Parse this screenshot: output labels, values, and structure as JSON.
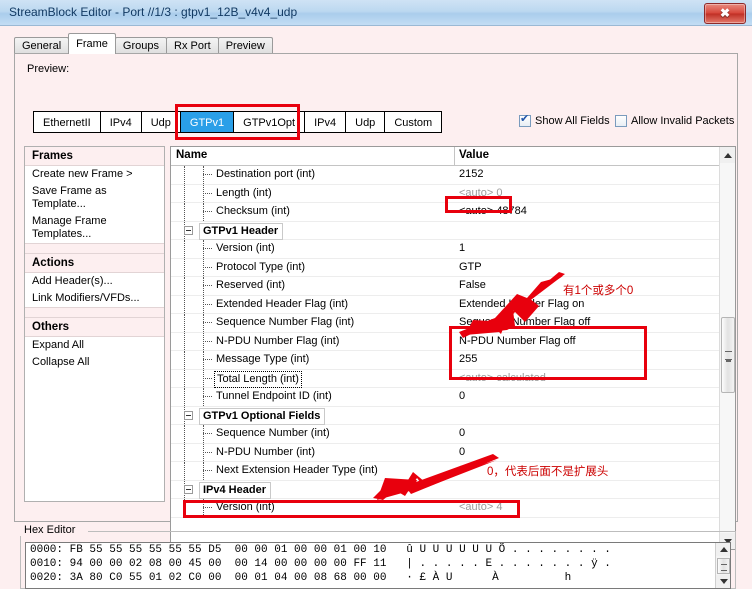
{
  "window": {
    "title": "StreamBlock Editor - Port //1/3 : gtpv1_12B_v4v4_udp",
    "close_label": "✖"
  },
  "tabs": [
    {
      "label": "General",
      "active": false
    },
    {
      "label": "Frame",
      "active": true
    },
    {
      "label": "Groups",
      "active": false
    },
    {
      "label": "Rx Port",
      "active": false
    },
    {
      "label": "Preview",
      "active": false
    }
  ],
  "preview": {
    "label": "Preview:",
    "buttons": [
      {
        "label": "EthernetII",
        "selected": false
      },
      {
        "label": "IPv4",
        "selected": false
      },
      {
        "label": "Udp",
        "selected": false
      },
      {
        "label": "GTPv1",
        "selected": true
      },
      {
        "label": "GTPv1Opt",
        "selected": false
      },
      {
        "label": "IPv4",
        "selected": false
      },
      {
        "label": "Udp",
        "selected": false
      },
      {
        "label": "Custom",
        "selected": false
      }
    ]
  },
  "options": {
    "show_all_fields": {
      "label": "Show All Fields",
      "checked": true
    },
    "allow_invalid_packets": {
      "label": "Allow Invalid Packets",
      "checked": false
    }
  },
  "sidebar": {
    "sections": [
      {
        "header": "Frames",
        "items": [
          "Create new Frame >",
          "Save Frame as Template...",
          "Manage Frame Templates..."
        ]
      },
      {
        "header": "Actions",
        "items": [
          "Add Header(s)...",
          "Link Modifiers/VFDs..."
        ]
      },
      {
        "header": "Others",
        "items": [
          "Expand All",
          "Collapse All"
        ]
      }
    ]
  },
  "tree": {
    "columns": {
      "name": "Name",
      "value": "Value"
    },
    "rows": [
      {
        "type": "child",
        "name": "Destination port (int)",
        "value": "2152",
        "auto": false
      },
      {
        "type": "child",
        "name": "Length (int)",
        "value": "<auto> 0",
        "auto": true
      },
      {
        "type": "child",
        "name": "Checksum (int)",
        "value": "<auto> 48784",
        "auto": true
      },
      {
        "type": "group",
        "name": "GTPv1 Header",
        "value": ""
      },
      {
        "type": "child",
        "name": "Version (int)",
        "value": "1",
        "auto": false
      },
      {
        "type": "child",
        "name": "Protocol Type (int)",
        "value": "GTP",
        "auto": false
      },
      {
        "type": "child",
        "name": "Reserved (int)",
        "value": "False",
        "auto": false
      },
      {
        "type": "child",
        "name": "Extended Header Flag (int)",
        "value": "Extended Header Flag on",
        "auto": false
      },
      {
        "type": "child",
        "name": "Sequence Number Flag (int)",
        "value": "Sequence Number Flag off",
        "auto": false
      },
      {
        "type": "child",
        "name": "N-PDU Number Flag (int)",
        "value": "N-PDU Number Flag off",
        "auto": false
      },
      {
        "type": "child",
        "name": "Message Type (int)",
        "value": "255",
        "auto": false
      },
      {
        "type": "child",
        "name": "Total Length (int)",
        "value": "<auto> calculated",
        "auto": true,
        "focused": true
      },
      {
        "type": "child",
        "name": "Tunnel Endpoint ID (int)",
        "value": "0",
        "auto": false
      },
      {
        "type": "group",
        "name": "GTPv1 Optional Fields",
        "value": ""
      },
      {
        "type": "child",
        "name": "Sequence Number (int)",
        "value": "0",
        "auto": false
      },
      {
        "type": "child",
        "name": "N-PDU Number (int)",
        "value": "0",
        "auto": false
      },
      {
        "type": "child",
        "name": "Next Extension Header Type (int)",
        "value": "0",
        "auto": false
      },
      {
        "type": "group",
        "name": "IPv4 Header",
        "value": ""
      },
      {
        "type": "child",
        "name": "Version (int)",
        "value": "<auto> 4",
        "auto": true
      }
    ]
  },
  "annotations": {
    "note_flags": "有1个或多个0",
    "note_next_ext": "0，代表后面不是扩展头",
    "color": "#cc0000",
    "box_color": "#e8000d"
  },
  "hex_editor": {
    "legend": "Hex Editor",
    "lines": [
      "0000: FB 55 55 55 55 55 55 D5  00 00 01 00 00 01 00 10   û U U U U U U Õ . . . . . . . .",
      "0010: 94 00 00 02 08 00 45 00  00 14 00 00 00 00 FF 11   | . . . . . E . . . . . . . ÿ .",
      "0020: 3A 80 C0 55 01 02 C0 00  00 01 04 00 08 68 00 00   · £ À U      À          h"
    ]
  }
}
